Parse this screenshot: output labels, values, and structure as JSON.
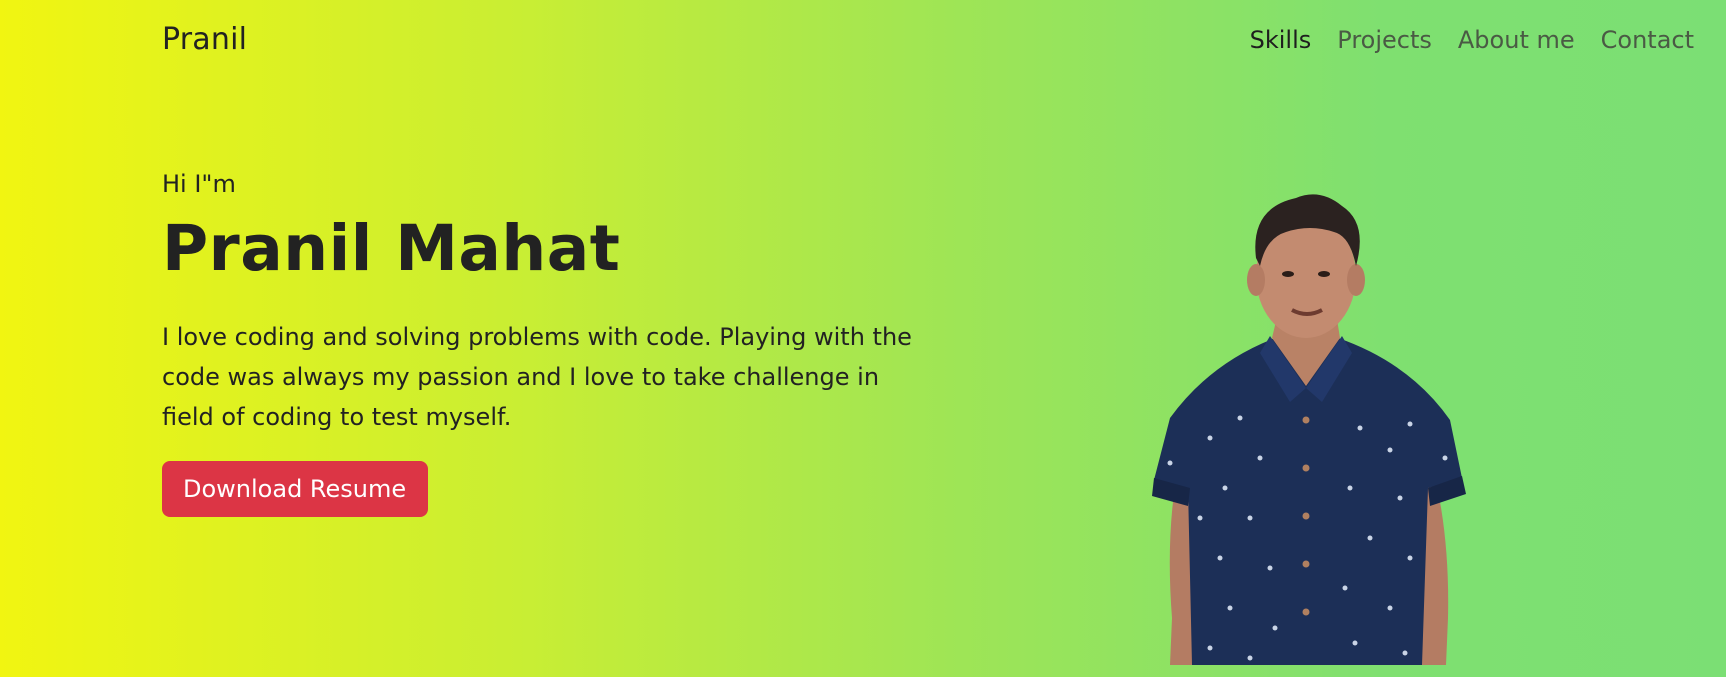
{
  "header": {
    "brand": "Pranil",
    "nav": [
      {
        "label": "Skills",
        "active": true
      },
      {
        "label": "Projects",
        "active": false
      },
      {
        "label": "About me",
        "active": false
      },
      {
        "label": "Contact",
        "active": false
      }
    ]
  },
  "hero": {
    "greeting": "Hi I\"m",
    "name": "Pranil Mahat",
    "bio": "I love coding and solving problems with code. Playing with the code was always my passion and I love to take challenge in field of coding to test myself.",
    "button_label": "Download Resume"
  },
  "colors": {
    "gradient_start": "#f1f511",
    "gradient_end": "#7bdf74",
    "button": "#dc3545",
    "shirt": "#1c2f57"
  }
}
